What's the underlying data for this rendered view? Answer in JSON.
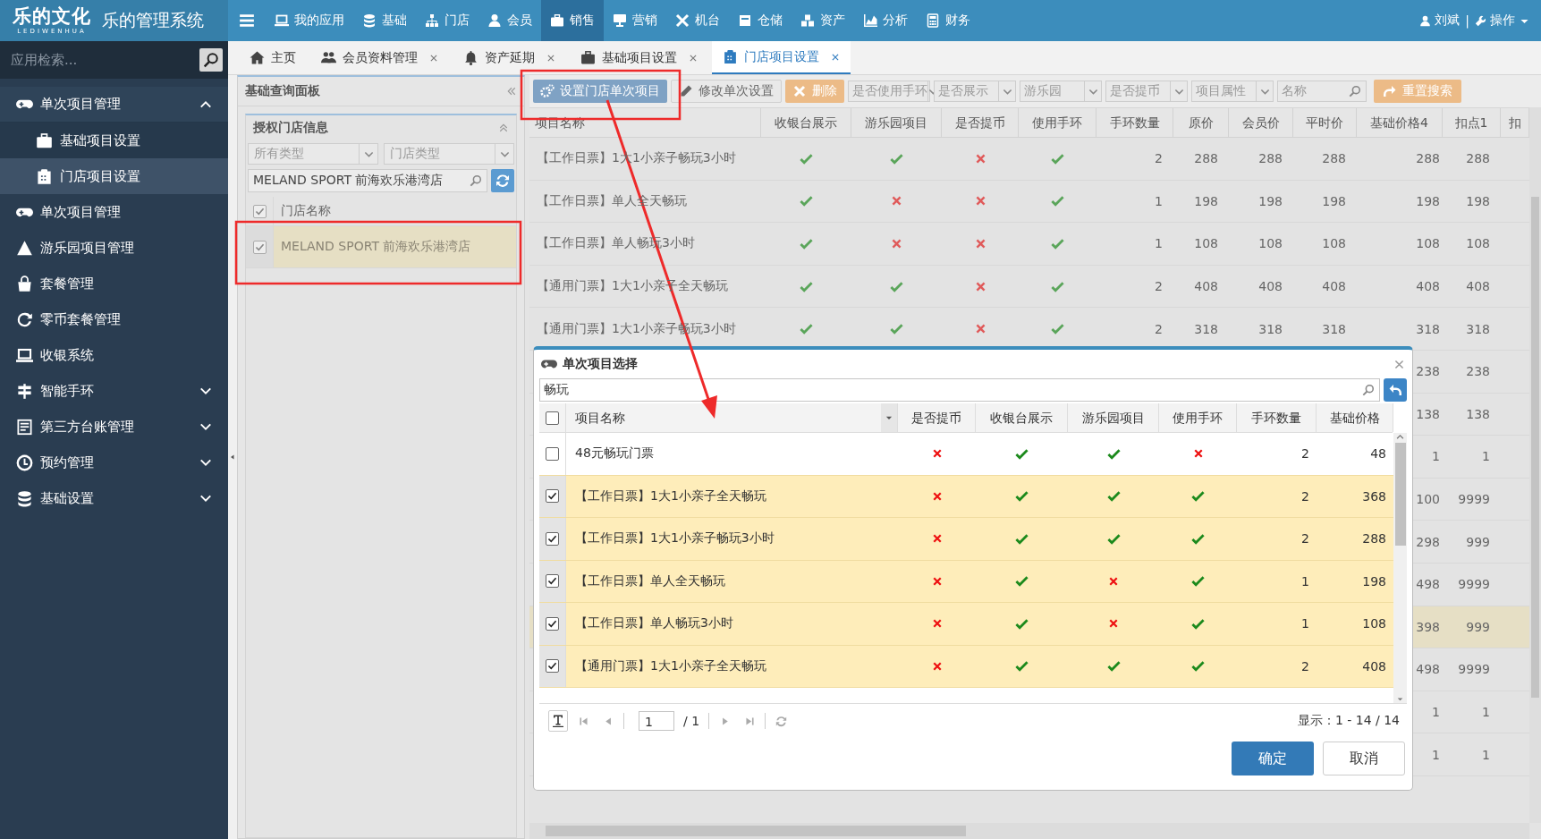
{
  "brand": {
    "logo": "乐的文化",
    "logo_sub": "LEDIWENHUA",
    "system": "乐的管理系统"
  },
  "top_menu": [
    {
      "label": "我的应用",
      "selected": false
    },
    {
      "label": "基础",
      "selected": false
    },
    {
      "label": "门店",
      "selected": false
    },
    {
      "label": "会员",
      "selected": false
    },
    {
      "label": "销售",
      "selected": true
    },
    {
      "label": "营销",
      "selected": false
    },
    {
      "label": "机台",
      "selected": false
    },
    {
      "label": "仓储",
      "selected": false
    },
    {
      "label": "资产",
      "selected": false
    },
    {
      "label": "分析",
      "selected": false
    },
    {
      "label": "财务",
      "selected": false
    }
  ],
  "user": {
    "name": "刘斌",
    "separator": "|",
    "action": "操作"
  },
  "sidebar": {
    "search": {
      "placeholder": "应用检索..."
    },
    "items": [
      {
        "label": "单次项目管理",
        "selected": false,
        "expanded": true,
        "children": [
          {
            "label": "基础项目设置",
            "selected": false
          },
          {
            "label": "门店项目设置",
            "selected": true
          }
        ]
      },
      {
        "label": "单次项目管理",
        "selected": false
      },
      {
        "label": "游乐园项目管理",
        "selected": false
      },
      {
        "label": "套餐管理",
        "selected": false
      },
      {
        "label": "零币套餐管理",
        "selected": false
      },
      {
        "label": "收银系统",
        "selected": false
      },
      {
        "label": "智能手环",
        "selected": false,
        "expanded": false
      },
      {
        "label": "第三方台账管理",
        "selected": false,
        "expanded": false
      },
      {
        "label": "预约管理",
        "selected": false,
        "expanded": false
      },
      {
        "label": "基础设置",
        "selected": false,
        "expanded": false
      }
    ]
  },
  "tabs": [
    {
      "label": "主页",
      "closable": false,
      "selected": false
    },
    {
      "label": "会员资料管理",
      "closable": true,
      "selected": false
    },
    {
      "label": "资产延期",
      "closable": true,
      "selected": false
    },
    {
      "label": "基础项目设置",
      "closable": true,
      "selected": false
    },
    {
      "label": "门店项目设置",
      "closable": true,
      "selected": true
    }
  ],
  "panel": {
    "title": "基础查询面板",
    "section": "授权门店信息",
    "filters": [
      {
        "placeholder": "所有类型"
      },
      {
        "placeholder": "门店类型"
      }
    ],
    "search": {
      "value": "MELAND SPORT 前海欢乐港湾店"
    },
    "header_checked": true,
    "column": "门店名称",
    "rows": [
      {
        "name": "MELAND SPORT 前海欢乐港湾店",
        "checked": true,
        "selected": true
      }
    ]
  },
  "toolbar": {
    "buttons": [
      {
        "label": "设置门店单次项目",
        "kind": "primary"
      },
      {
        "label": "修改单次设置",
        "kind": "plain"
      },
      {
        "label": "删除",
        "kind": "danger"
      }
    ],
    "filters": [
      {
        "placeholder": "是否使用手环"
      },
      {
        "placeholder": "是否展示"
      },
      {
        "placeholder": "游乐园"
      },
      {
        "placeholder": "是否提币"
      },
      {
        "placeholder": "项目属性"
      }
    ],
    "name_search": {
      "placeholder": "名称"
    },
    "reset": {
      "label": "重置搜索"
    }
  },
  "table": {
    "columns": [
      "项目名称",
      "收银台展示",
      "游乐园项目",
      "是否提币",
      "使用手环",
      "手环数量",
      "原价",
      "会员价",
      "平时价",
      "基础价格4",
      "扣点1",
      "扣"
    ],
    "rows": [
      {
        "name": "【工作日票】1大1小亲子畅玩3小时",
        "cashier_display": true,
        "park_item": true,
        "withdraw_coin": false,
        "use_wristband": true,
        "wristband_count": "2",
        "price": "288",
        "member_price": "288",
        "regular_price": "288",
        "base_price_4": "288",
        "discount_1": "288",
        "selected": false
      },
      {
        "name": "【工作日票】单人全天畅玩",
        "cashier_display": true,
        "park_item": false,
        "withdraw_coin": false,
        "use_wristband": true,
        "wristband_count": "1",
        "price": "198",
        "member_price": "198",
        "regular_price": "198",
        "base_price_4": "198",
        "discount_1": "198",
        "selected": false
      },
      {
        "name": "【工作日票】单人畅玩3小时",
        "cashier_display": true,
        "park_item": false,
        "withdraw_coin": false,
        "use_wristband": true,
        "wristband_count": "1",
        "price": "108",
        "member_price": "108",
        "regular_price": "108",
        "base_price_4": "108",
        "discount_1": "108",
        "selected": false
      },
      {
        "name": "【通用门票】1大1小亲子全天畅玩",
        "cashier_display": true,
        "park_item": true,
        "withdraw_coin": false,
        "use_wristband": true,
        "wristband_count": "2",
        "price": "408",
        "member_price": "408",
        "regular_price": "408",
        "base_price_4": "408",
        "discount_1": "408",
        "selected": false
      },
      {
        "name": "【通用门票】1大1小亲子畅玩3小时",
        "cashier_display": true,
        "park_item": true,
        "withdraw_coin": false,
        "use_wristband": true,
        "wristband_count": "2",
        "price": "318",
        "member_price": "318",
        "regular_price": "318",
        "base_price_4": "318",
        "discount_1": "318",
        "selected": false
      },
      {
        "base_price_4": "238",
        "discount_1": "238",
        "selected": false
      },
      {
        "base_price_4": "138",
        "discount_1": "138",
        "selected": false
      },
      {
        "base_price_4": "1",
        "discount_1": "1",
        "selected": false
      },
      {
        "base_price_4": "100",
        "discount_1": "9999",
        "selected": false
      },
      {
        "base_price_4": "298",
        "discount_1": "999",
        "selected": false
      },
      {
        "base_price_4": "498",
        "discount_1": "9999",
        "selected": false
      },
      {
        "base_price_4": "398",
        "discount_1": "999",
        "selected": true
      },
      {
        "base_price_4": "498",
        "discount_1": "9999",
        "selected": false
      },
      {
        "base_price_4": "1",
        "discount_1": "1",
        "selected": false
      },
      {
        "base_price_4": "1",
        "discount_1": "1",
        "selected": false
      }
    ]
  },
  "dialog": {
    "title": "单次项目选择",
    "search": {
      "value": "畅玩"
    },
    "header_checked": false,
    "columns": [
      "项目名称",
      "是否提币",
      "收银台展示",
      "游乐园项目",
      "使用手环",
      "手环数量",
      "基础价格"
    ],
    "rows": [
      {
        "name": "48元畅玩门票",
        "checked": false,
        "withdraw_coin": false,
        "cashier_display": true,
        "park_item": true,
        "use_wristband": false,
        "wristband_count": "2",
        "base_price": "48"
      },
      {
        "name": "【工作日票】1大1小亲子全天畅玩",
        "checked": true,
        "withdraw_coin": false,
        "cashier_display": true,
        "park_item": true,
        "use_wristband": true,
        "wristband_count": "2",
        "base_price": "368"
      },
      {
        "name": "【工作日票】1大1小亲子畅玩3小时",
        "checked": true,
        "withdraw_coin": false,
        "cashier_display": true,
        "park_item": true,
        "use_wristband": true,
        "wristband_count": "2",
        "base_price": "288"
      },
      {
        "name": "【工作日票】单人全天畅玩",
        "checked": true,
        "withdraw_coin": false,
        "cashier_display": true,
        "park_item": false,
        "use_wristband": true,
        "wristband_count": "1",
        "base_price": "198"
      },
      {
        "name": "【工作日票】单人畅玩3小时",
        "checked": true,
        "withdraw_coin": false,
        "cashier_display": true,
        "park_item": false,
        "use_wristband": true,
        "wristband_count": "1",
        "base_price": "108"
      },
      {
        "name": "【通用门票】1大1小亲子全天畅玩",
        "checked": true,
        "withdraw_coin": false,
        "cashier_display": true,
        "park_item": true,
        "use_wristband": true,
        "wristband_count": "2",
        "base_price": "408"
      }
    ],
    "pager": {
      "page": "1",
      "total_pages": "/ 1",
      "summary": "显示：1 - 14 / 14"
    },
    "buttons": [
      {
        "label": "确定",
        "kind": "primary"
      },
      {
        "label": "取消",
        "kind": "default"
      }
    ]
  }
}
